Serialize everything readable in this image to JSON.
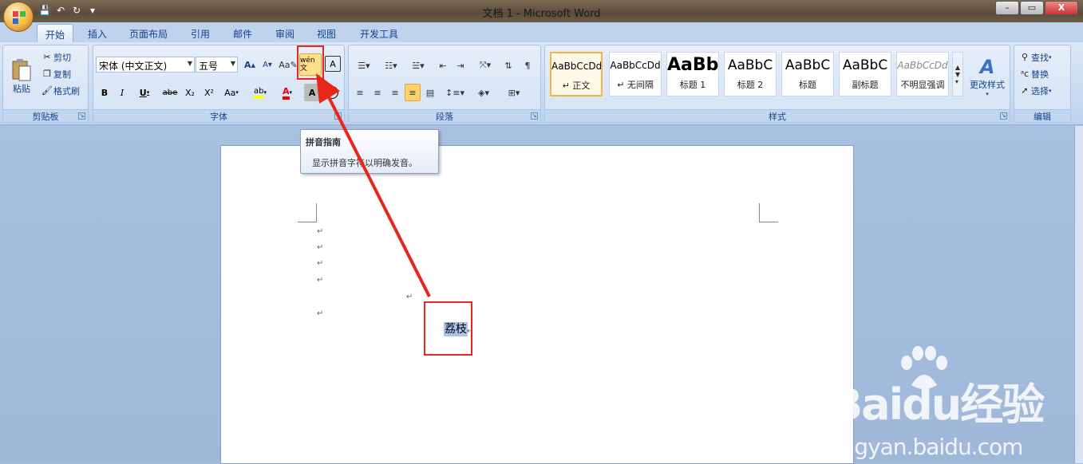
{
  "window": {
    "title": "文档 1 - Microsoft Word"
  },
  "window_controls": {
    "minimize": "–",
    "restore": "▭",
    "close": "X"
  },
  "qat": {
    "save": "💾",
    "undo": "↶",
    "redo": "↻",
    "more": "▾"
  },
  "tabs": [
    {
      "label": "开始",
      "active": true
    },
    {
      "label": "插入"
    },
    {
      "label": "页面布局"
    },
    {
      "label": "引用"
    },
    {
      "label": "邮件"
    },
    {
      "label": "审阅"
    },
    {
      "label": "视图"
    },
    {
      "label": "开发工具"
    }
  ],
  "clipboard": {
    "group_label": "剪贴板",
    "paste": "粘贴",
    "cut": "剪切",
    "copy": "复制",
    "format_painter": "格式刷"
  },
  "font": {
    "group_label": "字体",
    "font_name": "宋体 (中文正文)",
    "font_size": "五号",
    "grow": "A",
    "shrink": "A",
    "phonetic": "wén 文",
    "border_char": "A",
    "bold": "B",
    "italic": "I",
    "underline": "U",
    "strike": "abe",
    "subscript": "X₂",
    "superscript": "X²",
    "change_case": "Aa",
    "highlight": "ab",
    "font_color": "A",
    "shading": "A",
    "enclose": "字"
  },
  "paragraph": {
    "group_label": "段落"
  },
  "styles": {
    "group_label": "样式",
    "items": [
      {
        "sample": "AaBbCcDd",
        "name": "↵ 正文"
      },
      {
        "sample": "AaBbCcDd",
        "name": "↵ 无间隔"
      },
      {
        "sample": "AaBb",
        "name": "标题 1"
      },
      {
        "sample": "AaBbC",
        "name": "标题 2"
      },
      {
        "sample": "AaBbC",
        "name": "标题"
      },
      {
        "sample": "AaBbC",
        "name": "副标题"
      },
      {
        "sample": "AaBbCcDd",
        "name": "不明显强调"
      }
    ],
    "change_styles": "更改样式"
  },
  "editing": {
    "group_label": "编辑",
    "find": "查找",
    "replace": "替换",
    "select": "选择"
  },
  "tooltip": {
    "title": "拼音指南",
    "desc": "显示拼音字符以明确发音。"
  },
  "document": {
    "para_mark": "↵",
    "selected_text": "荔枝"
  },
  "watermark": {
    "brand": "Baidu经验",
    "url": "jingyan.baidu.com"
  },
  "colors": {
    "accent": "#e8261a",
    "ribbon": "#c7daf1"
  }
}
